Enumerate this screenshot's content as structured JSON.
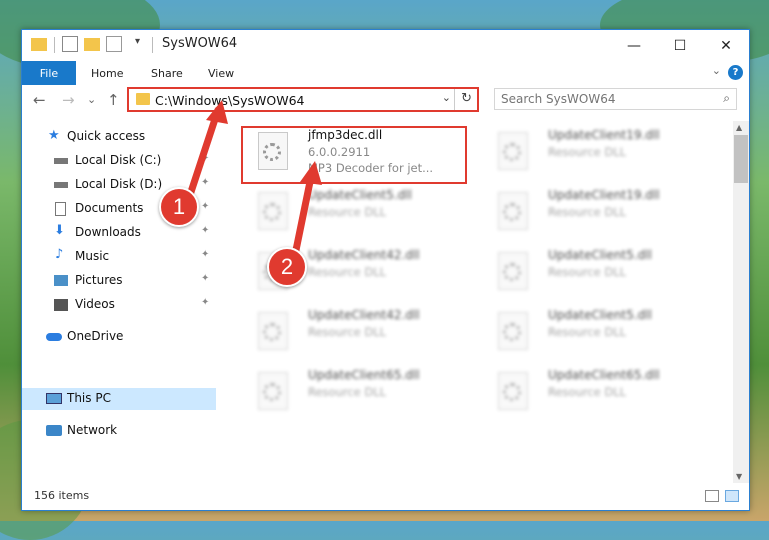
{
  "window": {
    "title": "SysWOW64",
    "buttons": {
      "minimize": "—",
      "maximize": "☐",
      "close": "✕"
    }
  },
  "ribbon": {
    "tabs": [
      "File",
      "Home",
      "Share",
      "View"
    ],
    "help": "?",
    "collapse": "⌄"
  },
  "nav": {
    "back": "←",
    "forward": "→",
    "recent": "⌄",
    "up": "↑",
    "address": "C:\\Windows\\SysWOW64",
    "address_dropdown": "⌄",
    "refresh": "↻",
    "search_placeholder": "Search SysWOW64",
    "search_icon": "⌕"
  },
  "sidebar": {
    "items": [
      {
        "label": "Quick access",
        "icon": "star-icon",
        "pinned": false
      },
      {
        "label": "Local Disk (C:)",
        "icon": "drive-icon",
        "pinned": true
      },
      {
        "label": "Local Disk (D:)",
        "icon": "drive-icon",
        "pinned": true
      },
      {
        "label": "Documents",
        "icon": "documents-icon",
        "pinned": true
      },
      {
        "label": "Downloads",
        "icon": "downloads-icon",
        "pinned": true
      },
      {
        "label": "Music",
        "icon": "music-icon",
        "pinned": true
      },
      {
        "label": "Pictures",
        "icon": "pictures-icon",
        "pinned": true
      },
      {
        "label": "Videos",
        "icon": "videos-icon",
        "pinned": true
      },
      {
        "label": "OneDrive",
        "icon": "onedrive-icon",
        "pinned": false
      },
      {
        "label": "This PC",
        "icon": "computer-icon",
        "pinned": false
      },
      {
        "label": "Network",
        "icon": "network-icon",
        "pinned": false
      }
    ],
    "pin_glyph": "✦"
  },
  "files": [
    {
      "name": "jfmp3dec.dll",
      "line1": "6.0.0.2911",
      "line2": "MP3 Decoder for jet...",
      "blurred": false
    },
    {
      "name": "UpdateClient19.dll",
      "line1": "Resource DLL",
      "line2": "",
      "blurred": true
    },
    {
      "name": "UpdateClient5.dll",
      "line1": "Resource DLL",
      "line2": "",
      "blurred": true
    },
    {
      "name": "UpdateClient19.dll",
      "line1": "Resource DLL",
      "line2": "",
      "blurred": true
    },
    {
      "name": "UpdateClient42.dll",
      "line1": "Resource DLL",
      "line2": "",
      "blurred": true
    },
    {
      "name": "UpdateClient5.dll",
      "line1": "Resource DLL",
      "line2": "",
      "blurred": true
    },
    {
      "name": "UpdateClient42.dll",
      "line1": "Resource DLL",
      "line2": "",
      "blurred": true
    },
    {
      "name": "UpdateClient5.dll",
      "line1": "Resource DLL",
      "line2": "",
      "blurred": true
    },
    {
      "name": "UpdateClient65.dll",
      "line1": "Resource DLL",
      "line2": "",
      "blurred": true
    },
    {
      "name": "UpdateClient65.dll",
      "line1": "Resource DLL",
      "line2": "",
      "blurred": true
    }
  ],
  "status": {
    "count": "156 items"
  },
  "annotations": {
    "step1": "1",
    "step2": "2"
  },
  "colors": {
    "accent": "#1979ca",
    "highlight": "#e03a2f",
    "selected": "#cce8ff"
  }
}
